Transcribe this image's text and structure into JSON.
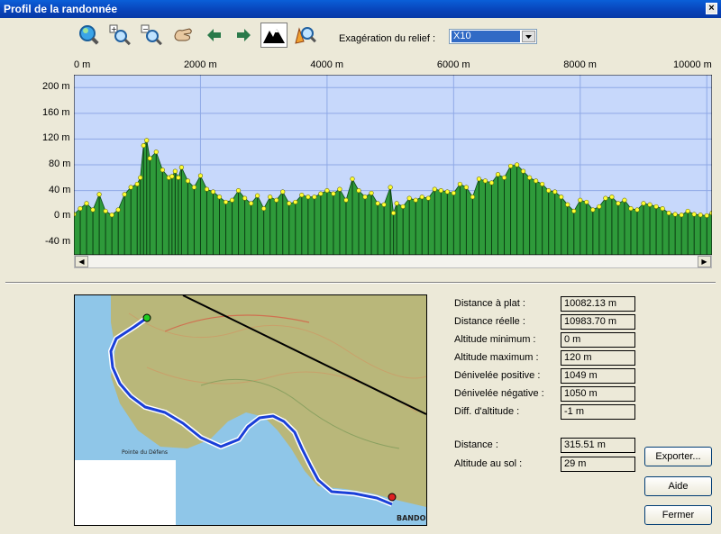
{
  "window": {
    "title": "Profil de la randonnée",
    "close_glyph": "×"
  },
  "toolbar": {
    "icons": [
      "zoom-extent-icon",
      "zoom-in-icon",
      "zoom-out-icon",
      "pan-hand-icon",
      "arrow-left-icon",
      "arrow-right-icon",
      "profile-mountain-icon",
      "profile-tool-icon"
    ],
    "relief_label": "Exagération du relief :",
    "relief_value": "X10"
  },
  "chart_data": {
    "type": "area",
    "x_unit": "m",
    "x_ticks": [
      {
        "v": 0,
        "label": "0 m"
      },
      {
        "v": 2000,
        "label": "2000 m"
      },
      {
        "v": 4000,
        "label": "4000 m"
      },
      {
        "v": 6000,
        "label": "6000 m"
      },
      {
        "v": 8000,
        "label": "8000 m"
      },
      {
        "v": 10000,
        "label": "10000 m"
      }
    ],
    "y_ticks": [
      {
        "v": 200,
        "label": "200 m"
      },
      {
        "v": 160,
        "label": "160 m"
      },
      {
        "v": 120,
        "label": "120 m"
      },
      {
        "v": 80,
        "label": "80 m"
      },
      {
        "v": 40,
        "label": "40 m"
      },
      {
        "v": 0,
        "label": "0 m"
      },
      {
        "v": -40,
        "label": "-40 m"
      }
    ],
    "xlim": [
      0,
      10082
    ],
    "ylim": [
      -60,
      220
    ],
    "grid": true,
    "colors": {
      "background": "#c7d8fb",
      "fill": "#2e9a3a",
      "point": "#ffff33",
      "grid": "#8fa9e6"
    },
    "x": [
      0,
      100,
      200,
      300,
      400,
      500,
      600,
      700,
      800,
      900,
      1000,
      1050,
      1100,
      1150,
      1200,
      1300,
      1400,
      1500,
      1550,
      1600,
      1650,
      1700,
      1800,
      1900,
      2000,
      2100,
      2200,
      2300,
      2400,
      2500,
      2600,
      2700,
      2800,
      2900,
      3000,
      3100,
      3200,
      3300,
      3400,
      3500,
      3600,
      3700,
      3800,
      3900,
      4000,
      4100,
      4200,
      4300,
      4400,
      4500,
      4600,
      4700,
      4800,
      4900,
      5000,
      5050,
      5100,
      5200,
      5300,
      5400,
      5500,
      5600,
      5700,
      5800,
      5900,
      6000,
      6100,
      6200,
      6300,
      6400,
      6500,
      6600,
      6700,
      6800,
      6900,
      7000,
      7100,
      7200,
      7300,
      7400,
      7500,
      7600,
      7700,
      7800,
      7900,
      8000,
      8100,
      8200,
      8300,
      8400,
      8500,
      8600,
      8700,
      8800,
      8900,
      9000,
      9100,
      9200,
      9300,
      9400,
      9500,
      9600,
      9700,
      9800,
      9900,
      10000,
      10082
    ],
    "y": [
      3,
      12,
      20,
      10,
      34,
      8,
      2,
      10,
      34,
      45,
      50,
      60,
      110,
      118,
      90,
      100,
      72,
      60,
      62,
      70,
      60,
      76,
      55,
      45,
      63,
      42,
      38,
      30,
      22,
      25,
      40,
      28,
      20,
      32,
      12,
      30,
      25,
      38,
      20,
      22,
      33,
      30,
      30,
      35,
      40,
      35,
      42,
      25,
      58,
      40,
      30,
      36,
      20,
      18,
      45,
      5,
      20,
      15,
      28,
      25,
      30,
      28,
      42,
      40,
      38,
      36,
      50,
      45,
      30,
      58,
      55,
      52,
      65,
      60,
      78,
      80,
      70,
      60,
      55,
      50,
      40,
      38,
      30,
      18,
      8,
      25,
      22,
      10,
      15,
      28,
      30,
      20,
      25,
      12,
      10,
      20,
      18,
      15,
      12,
      5,
      3,
      2,
      8,
      3,
      2,
      1,
      5
    ]
  },
  "stats": [
    {
      "label": "Distance à plat :",
      "value": "10082.13 m"
    },
    {
      "label": "Distance réelle :",
      "value": "10983.70 m"
    },
    {
      "label": "Altitude minimum :",
      "value": "0 m"
    },
    {
      "label": "Altitude maximum :",
      "value": "120 m"
    },
    {
      "label": "Dénivelée positive :",
      "value": "1049 m"
    },
    {
      "label": "Dénivelée négative :",
      "value": "1050 m"
    },
    {
      "label": "Diff. d'altitude :",
      "value": "-1 m"
    }
  ],
  "cursor": [
    {
      "label": "Distance :",
      "value": "315.51 m"
    },
    {
      "label": "Altitude au sol :",
      "value": "29 m"
    }
  ],
  "buttons": {
    "export": "Exporter...",
    "help": "Aide",
    "close": "Fermer"
  },
  "map": {
    "labels": [
      "Pointe du Défens",
      "BANDOL"
    ],
    "colors": {
      "sea": "#8fc6e8",
      "land": "#b9b77a",
      "route": "#1a3fd8",
      "route_halo": "#ffffff",
      "start": "#22cc22",
      "end": "#dd2222"
    }
  }
}
